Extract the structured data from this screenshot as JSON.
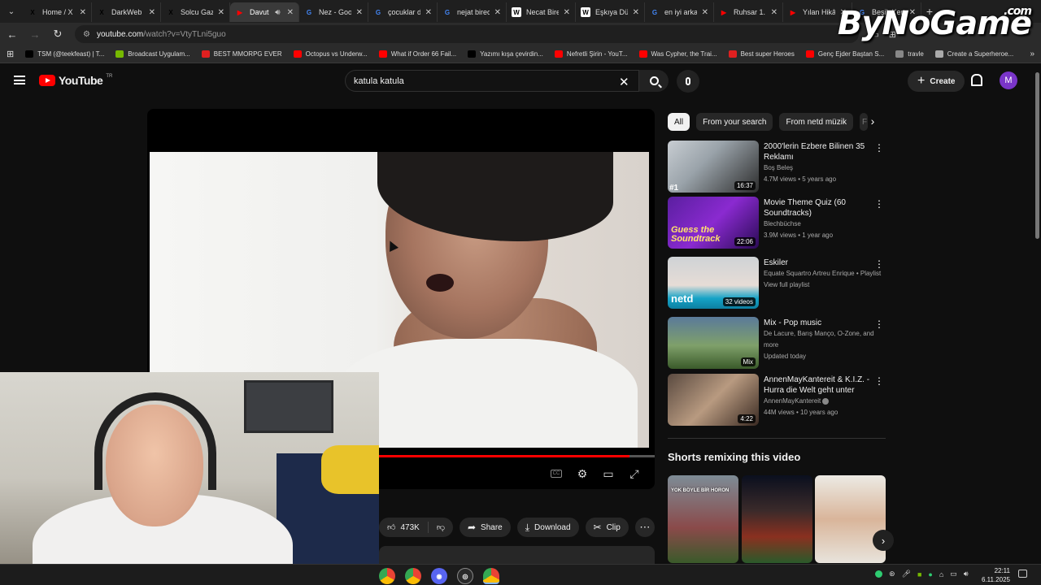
{
  "browser": {
    "tabs": [
      {
        "title": "Home / X",
        "fav": "X",
        "color": "#000000",
        "active": false
      },
      {
        "title": "DarkWeb |",
        "fav": "X",
        "color": "#000000",
        "active": false
      },
      {
        "title": "Solcu Gaze",
        "fav": "X",
        "color": "#000000",
        "active": false
      },
      {
        "title": "Davut",
        "fav": "▶",
        "color": "#ff0000",
        "active": true
      },
      {
        "title": "Nez - Goo",
        "fav": "G",
        "color": "#4285f4",
        "active": false
      },
      {
        "title": "çocuklar d",
        "fav": "G",
        "color": "#4285f4",
        "active": false
      },
      {
        "title": "nejat birec",
        "fav": "G",
        "color": "#4285f4",
        "active": false
      },
      {
        "title": "Necat Bire",
        "fav": "W",
        "color": "#ffffff",
        "active": false
      },
      {
        "title": "Eşkıya Dür",
        "fav": "W",
        "color": "#ffffff",
        "active": false
      },
      {
        "title": "en iyi arka",
        "fav": "G",
        "color": "#4285f4",
        "active": false
      },
      {
        "title": "Ruhsar 1.",
        "fav": "▶",
        "color": "#ff0000",
        "active": false
      },
      {
        "title": "Yılan Hikâ",
        "fav": "▶",
        "color": "#ff0000",
        "active": false
      },
      {
        "title": "Beşik Kert",
        "fav": "G",
        "color": "#4285f4",
        "active": false
      }
    ],
    "url_host": "youtube.com",
    "url_path": "/watch?v=VtyTLni5guo",
    "bookmarks": [
      {
        "label": "TSM (@teekfeast) | T...",
        "color": "#000000"
      },
      {
        "label": "Broadcast Uygulam...",
        "color": "#76b900"
      },
      {
        "label": "BEST MMORPG EVER",
        "color": "#e02020"
      },
      {
        "label": "Octopus vs Underw...",
        "color": "#ff0000"
      },
      {
        "label": "What if Order 66 Fail...",
        "color": "#ff0000"
      },
      {
        "label": "Yazımı kışa çevirdin...",
        "color": "#000000"
      },
      {
        "label": "Nefretli Şirin - YouT...",
        "color": "#ff0000"
      },
      {
        "label": "Was Cypher, the Trai...",
        "color": "#ff0000"
      },
      {
        "label": "Best super Heroes",
        "color": "#e02020"
      },
      {
        "label": "Genç Ejder Baştan S...",
        "color": "#ff0000"
      },
      {
        "label": "travle",
        "color": "#888888"
      },
      {
        "label": "Create a Superheroe...",
        "color": "#aaaaaa"
      }
    ]
  },
  "watermark": {
    "text": "ByNoGame",
    "suffix": ".com"
  },
  "youtube": {
    "logo": "YouTube",
    "logo_country": "TR",
    "search_value": "katula katula",
    "create_label": "Create",
    "avatar_letter": "M"
  },
  "player": {
    "progress": 0.95
  },
  "actions": {
    "likes": "473K",
    "share": "Share",
    "download": "Download",
    "clip": "Clip"
  },
  "chips": [
    "All",
    "From your search",
    "From netd müzik",
    "F"
  ],
  "recommendations": [
    {
      "title": "2000'lerin Ezbere Bilinen 35 Reklamı",
      "channel": "Boş Beleş",
      "meta": "4.7M views • 5 years ago",
      "duration": "16:37",
      "rank": "#1"
    },
    {
      "title": "Movie Theme Quiz (60 Soundtracks)",
      "channel": "Blechbüchse",
      "meta": "3.9M views • 1 year ago",
      "duration": "22:06",
      "thumb_text": "Guess the Soundtrack"
    },
    {
      "title": "Eskiler",
      "channel": "Equate Squartro Artreu Enrique • Playlist",
      "meta": "View full playlist",
      "duration": "32 videos",
      "thumb_text": "netd"
    },
    {
      "title": "Mix - Pop music",
      "channel": "De Lacure, Barış Manço, O-Zone, and more",
      "meta": "Updated today",
      "duration": "Mix"
    },
    {
      "title": "AnnenMayKantereit & K.I.Z. - Hurra die Welt geht unter",
      "channel": "AnnenMayKantereit",
      "meta": "44M views • 10 years ago",
      "duration": "4:22"
    }
  ],
  "shorts": {
    "title": "Shorts remixing this video",
    "first_caption": "YOK BÖYLE BİR HORON"
  },
  "taskbar": {
    "time": "22:11",
    "date": "6.11.2025"
  }
}
